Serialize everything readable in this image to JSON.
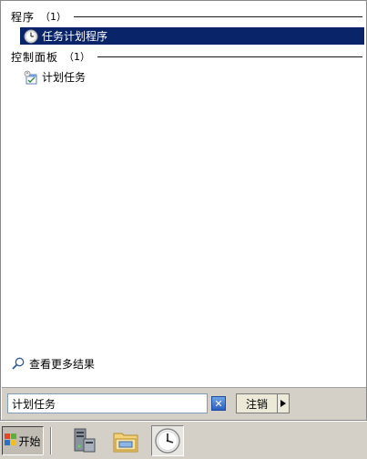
{
  "programs_group": {
    "title": "程序",
    "count": "（1）"
  },
  "programs_items": [
    {
      "label": "任务计划程序",
      "icon": "clock-icon",
      "selected": true
    }
  ],
  "control_panel_group": {
    "title": "控制面板",
    "count": "（1）"
  },
  "control_panel_items": [
    {
      "label": "计划任务",
      "icon": "scheduled-task-icon"
    }
  ],
  "see_more": {
    "label": "查看更多结果",
    "icon": "magnifier-icon"
  },
  "search": {
    "value": "计划任务",
    "clear_icon": "clear-x-icon"
  },
  "logoff": {
    "label": "注销"
  },
  "taskbar": {
    "start_label": "开始",
    "pinned": [
      {
        "name": "server-manager-icon"
      },
      {
        "name": "file-explorer-icon"
      },
      {
        "name": "clock-icon",
        "active": true
      }
    ]
  },
  "colors": {
    "selection": "#0a246a",
    "chrome": "#d4d0c8"
  }
}
